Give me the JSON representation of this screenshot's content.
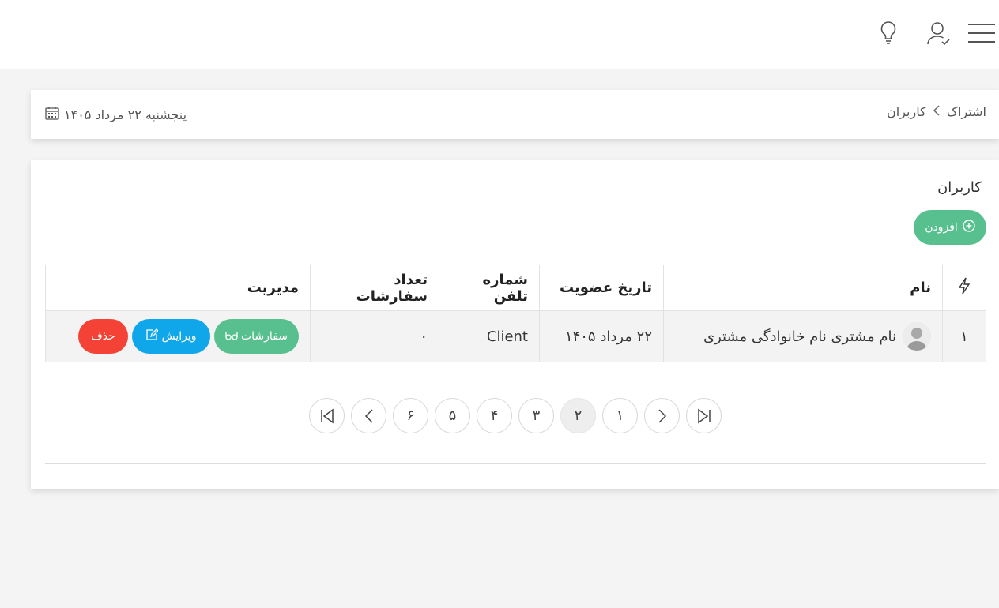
{
  "topbar": {
    "icons": [
      "menu-icon",
      "user-check-icon",
      "lightbulb-icon"
    ]
  },
  "breadcrumb": {
    "root": "اشتراک",
    "separator": "›",
    "current": "کاربران"
  },
  "date": {
    "text": "پنجشنبه ۲۲ مرداد ۱۴۰۵",
    "icon": "calendar-icon"
  },
  "panel": {
    "title": "کاربران",
    "add_label": "افزودن"
  },
  "table": {
    "headers": {
      "index_icon": "bolt-icon",
      "name": "نام",
      "join_date": "تاریخ عضویت",
      "phone": "شماره تلفن",
      "orders_count": "تعداد سفارشات",
      "manage": "مدیریت"
    },
    "rows": [
      {
        "index": "۱",
        "name": "نام مشتری نام خانوادگی مشتری",
        "join_date": "۲۲ مرداد ۱۴۰۵",
        "phone": "Client",
        "orders_count": "۰",
        "orders_label": "سفارشات",
        "edit_label": "ویرایش",
        "delete_label": "حذف"
      }
    ]
  },
  "pagination": {
    "pages": [
      "۱",
      "۲",
      "۳",
      "۴",
      "۵",
      "۶"
    ],
    "active": "۲"
  },
  "colors": {
    "green": "#58c08f",
    "blue": "#0fa6ea",
    "red": "#f44336",
    "background": "#f4f4f4"
  }
}
